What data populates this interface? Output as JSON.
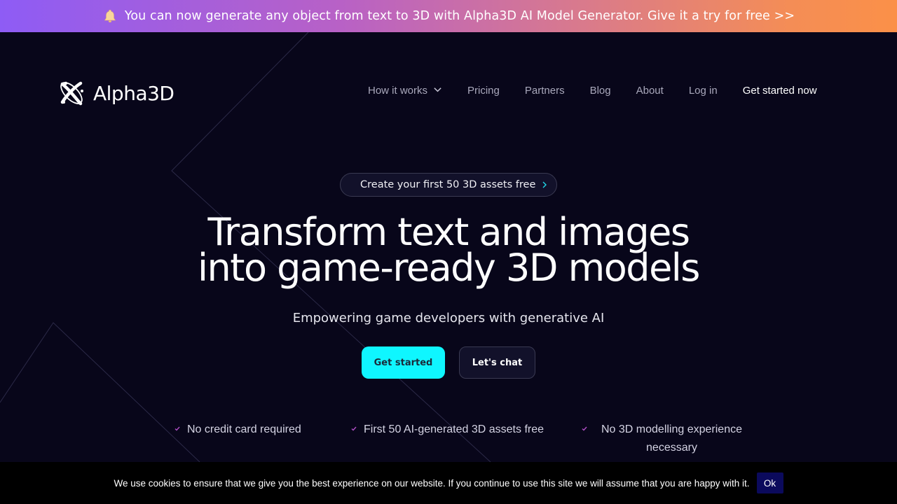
{
  "announcement": {
    "icon": "bell-icon",
    "text": "You can now generate any object from text to 3D with Alpha3D AI Model Generator. Give it a try for free >>"
  },
  "header": {
    "logo_text": "Alpha3D",
    "nav": [
      {
        "label": "How it works",
        "has_dropdown": true
      },
      {
        "label": "Pricing"
      },
      {
        "label": "Partners"
      },
      {
        "label": "Blog"
      },
      {
        "label": "About"
      },
      {
        "label": "Log in"
      },
      {
        "label": "Get started now"
      }
    ]
  },
  "hero": {
    "pill_label": "Create your first 50 3D assets free",
    "headline_line1": "Transform text and images",
    "headline_line2": "into game-ready 3D models",
    "subheadline": "Empowering game developers with generative AI",
    "primary_button": "Get started",
    "secondary_button": "Let's chat",
    "features": [
      "No credit card required",
      "First 50 AI-generated 3D assets free",
      "No 3D modelling experience necessary"
    ]
  },
  "cookie_banner": {
    "text": "We use cookies to ensure that we give you the best experience on our website. If you continue to use this site we will assume that you are happy with it.",
    "ok_label": "Ok"
  },
  "colors": {
    "background": "#08061a",
    "accent_cyan": "#0ff6ff",
    "banner_gradient_start": "#8e5cf5",
    "banner_gradient_end": "#fb9048",
    "check_color": "#b04fc6",
    "cookie_ok_bg": "#0b0a5c"
  }
}
